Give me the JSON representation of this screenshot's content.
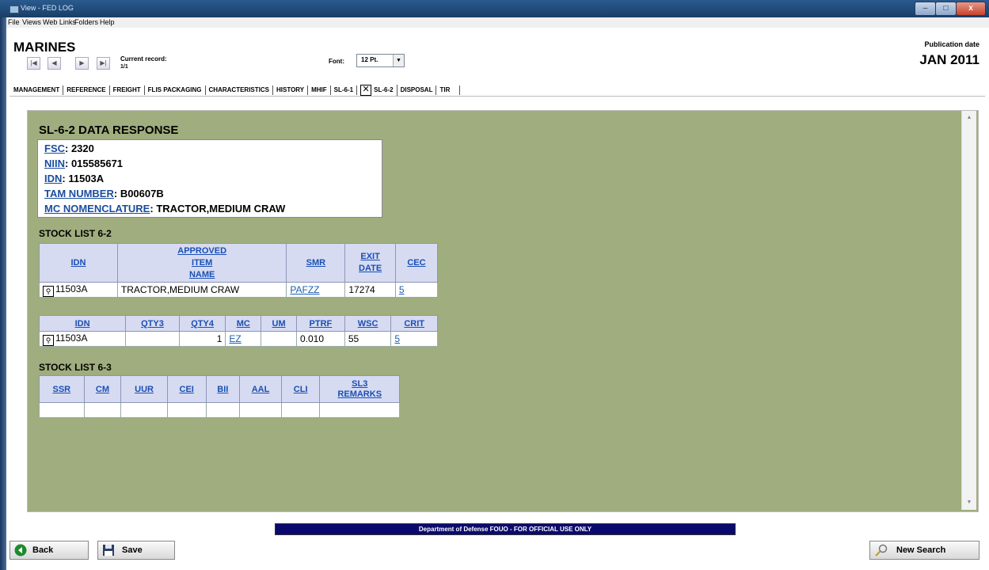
{
  "window": {
    "title": "View - FED LOG",
    "min_label": "–",
    "max_label": "□",
    "close_label": "x"
  },
  "menu": [
    "File",
    "Views",
    "Web Links",
    "Folders",
    "Help"
  ],
  "header": {
    "org": "MARINES",
    "nav": [
      "|◀",
      "◀",
      "▶",
      "▶|"
    ],
    "current_record_label": "Current record:",
    "current_record_value": "1/1",
    "font_label": "Font:",
    "font_value": "12 Pt.",
    "publication_label": "Publication date",
    "publication_date": "JAN 2011"
  },
  "tabs": [
    "MANAGEMENT",
    "REFERENCE",
    "FREIGHT",
    "FLIS PACKAGING",
    "CHARACTERISTICS",
    "HISTORY",
    "MHIF",
    "SL-6-1",
    "SL-6-2",
    "DISPOSAL",
    "TIR"
  ],
  "active_tab": "SL-6-2",
  "response": {
    "title": "SL-6-2 DATA RESPONSE",
    "fields": [
      {
        "label": "FSC",
        "value": "2320"
      },
      {
        "label": "NIIN",
        "value": "015585671"
      },
      {
        "label": "IDN",
        "value": "11503A"
      },
      {
        "label": "TAM NUMBER",
        "value": "B00607B"
      },
      {
        "label": "MC NOMENCLATURE",
        "value": "TRACTOR,MEDIUM CRAW"
      }
    ]
  },
  "sl62": {
    "title": "STOCK LIST 6-2",
    "table1": {
      "headers": [
        "IDN",
        "APPROVED\nITEM\nNAME",
        "SMR",
        "EXIT\nDATE",
        "CEC"
      ],
      "row": {
        "idn": "11503A",
        "name": "TRACTOR,MEDIUM CRAW",
        "smr": "PAFZZ",
        "exit_date": "17274",
        "cec": "5"
      }
    },
    "table2": {
      "headers": [
        "IDN",
        "QTY3",
        "QTY4",
        "MC",
        "UM",
        "PTRF",
        "WSC",
        "CRIT"
      ],
      "row": {
        "idn": "11503A",
        "qty3": "",
        "qty4": "1",
        "mc": "EZ",
        "um": "",
        "ptrf": "0.010",
        "wsc": "55",
        "crit": "5"
      }
    }
  },
  "sl63": {
    "title": "STOCK LIST 6-3",
    "headers": [
      "SSR",
      "CM",
      "UUR",
      "CEI",
      "BII",
      "AAL",
      "CLI",
      "SL3\nREMARKS"
    ]
  },
  "footer": {
    "banner": "Department of Defense FOUO - FOR OFFICIAL USE ONLY",
    "back": "Back",
    "save": "Save",
    "new_search": "New Search"
  },
  "colors": {
    "content_bg": "#a0ad7e",
    "header_fill": "#d6dbf2",
    "link": "#1a4fb3",
    "banner": "#0a0a6e"
  }
}
